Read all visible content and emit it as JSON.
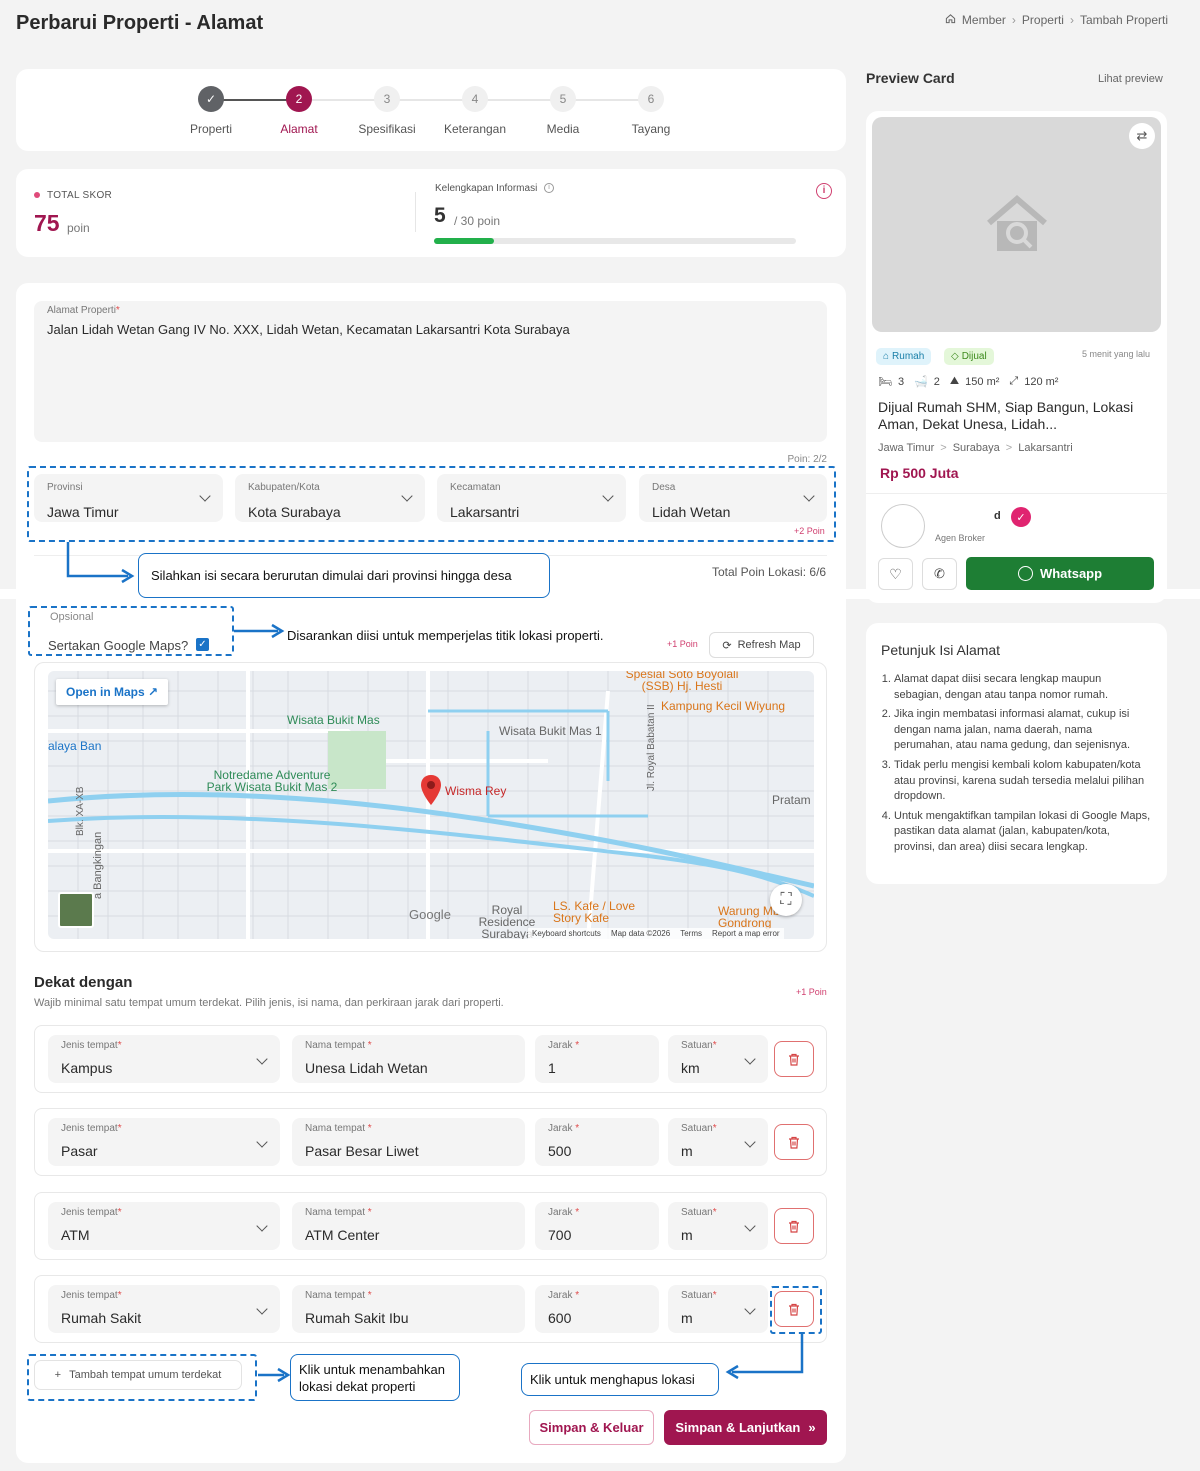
{
  "page": {
    "title": "Perbarui Properti - Alamat"
  },
  "breadcrumb": [
    "Member",
    "Properti",
    "Tambah Properti"
  ],
  "steps": [
    {
      "num": "1",
      "label": "Properti",
      "state": "done"
    },
    {
      "num": "2",
      "label": "Alamat",
      "state": "active"
    },
    {
      "num": "3",
      "label": "Spesifikasi",
      "state": "todo"
    },
    {
      "num": "4",
      "label": "Keterangan",
      "state": "todo"
    },
    {
      "num": "5",
      "label": "Media",
      "state": "todo"
    },
    {
      "num": "6",
      "label": "Tayang",
      "state": "todo"
    }
  ],
  "score": {
    "total_label": "TOTAL SKOR",
    "total_value": "75",
    "total_unit": "poin",
    "completeness_label": "Kelengkapan Informasi",
    "completeness_value": "5",
    "completeness_max": "/ 30 poin",
    "completeness_fraction": 0.1667
  },
  "address": {
    "label": "Alamat Properti",
    "value": "Jalan Lidah Wetan Gang IV No. XXX, Lidah Wetan, Kecamatan Lakarsantri Kota Surabaya",
    "poin": "Poin: 2/2"
  },
  "region": {
    "provinsi": {
      "label": "Provinsi",
      "value": "Jawa Timur"
    },
    "kota": {
      "label": "Kabupaten/Kota",
      "value": "Kota Surabaya"
    },
    "kecamatan": {
      "label": "Kecamatan",
      "value": "Lakarsantri"
    },
    "desa": {
      "label": "Desa",
      "value": "Lidah Wetan"
    },
    "poin": "+2 Poin",
    "total_poin": "Total Poin Lokasi: 6/6"
  },
  "notes": {
    "region": "Silahkan isi secara berurutan dimulai dari provinsi hingga desa",
    "maps": "Disarankan diisi untuk memperjelas titik lokasi properti.",
    "add": "Klik untuk menambahkan lokasi dekat properti",
    "delete": "Klik untuk menghapus lokasi"
  },
  "maps": {
    "optional_label": "Opsional",
    "include_label": "Sertakan Google Maps?",
    "poin": "+1 Poin",
    "refresh_label": "Refresh Map",
    "open_label": "Open in Maps",
    "pin_label": "Wisma Rey",
    "places": [
      "Spesial Soto Boyolali (SSB) Hj. Hesti",
      "Kampung Kecil Wiyung",
      "Wisata Bukit Mas",
      "Wisata Bukit Mas 1",
      "alaya Ban",
      "Notredame Adventure Park Wisata Bukit Mas 2",
      "Jl. Royal Babatan II",
      "Pratam",
      "Blk. XA-XB",
      "a Bangkingan",
      "Royal Residence Surabaya",
      "LS. Kafe / Love Story Kafe",
      "Warung Mbah Gondrong"
    ],
    "google": "Google",
    "footer": [
      "Keyboard shortcuts",
      "Map data ©2026",
      "Terms",
      "Report a map error"
    ]
  },
  "nearby": {
    "title": "Dekat dengan",
    "subtitle": "Wajib minimal satu tempat umum terdekat. Pilih jenis, isi nama, dan perkiraan jarak dari properti.",
    "poin": "+1 Poin",
    "col_labels": {
      "jenis": "Jenis tempat",
      "nama": "Nama tempat",
      "jarak": "Jarak",
      "satuan": "Satuan"
    },
    "rows": [
      {
        "jenis": "Kampus",
        "nama": "Unesa Lidah Wetan",
        "jarak": "1",
        "satuan": "km"
      },
      {
        "jenis": "Pasar",
        "nama": "Pasar Besar Liwet",
        "jarak": "500",
        "satuan": "m"
      },
      {
        "jenis": "ATM",
        "nama": "ATM Center",
        "jarak": "700",
        "satuan": "m"
      },
      {
        "jenis": "Rumah Sakit",
        "nama": "Rumah Sakit Ibu",
        "jarak": "600",
        "satuan": "m"
      }
    ],
    "add_label": "Tambah tempat umum terdekat"
  },
  "actions": {
    "save_exit": "Simpan & Keluar",
    "save_next": "Simpan & Lanjutkan"
  },
  "preview": {
    "title": "Preview Card",
    "link": "Lihat preview",
    "badge_type": "Rumah",
    "badge_status": "Dijual",
    "time": "5 menit yang lalu",
    "beds": "3",
    "baths": "2",
    "land": "150 m²",
    "building": "120 m²",
    "listing_title": "Dijual Rumah SHM, Siap Bangun, Lokasi Aman, Dekat Unesa, Lidah...",
    "loc": [
      "Jawa Timur",
      "Surabaya",
      "Lakarsantri"
    ],
    "price": "Rp 500 Juta",
    "agent_name": "d",
    "agent_role": "Agen Broker",
    "whatsapp": "Whatsapp"
  },
  "guide": {
    "title": "Petunjuk Isi Alamat",
    "items": [
      "Alamat dapat diisi secara lengkap maupun sebagian, dengan atau tanpa nomor rumah.",
      "Jika ingin membatasi informasi alamat, cukup isi dengan nama jalan, nama daerah, nama perumahan, atau nama gedung, dan sejenisnya.",
      "Tidak perlu mengisi kembali kolom kabupaten/kota atau provinsi, karena sudah tersedia melalui pilihan dropdown.",
      "Untuk mengaktifkan tampilan lokasi di Google Maps, pastikan data alamat (jalan, kabupaten/kota, provinsi, dan area) diisi secara lengkap."
    ]
  },
  "colors": {
    "brand": "#a01650",
    "accent_blue": "#1a73c7",
    "whatsapp": "#1e7e34",
    "progress": "#22b04b"
  }
}
